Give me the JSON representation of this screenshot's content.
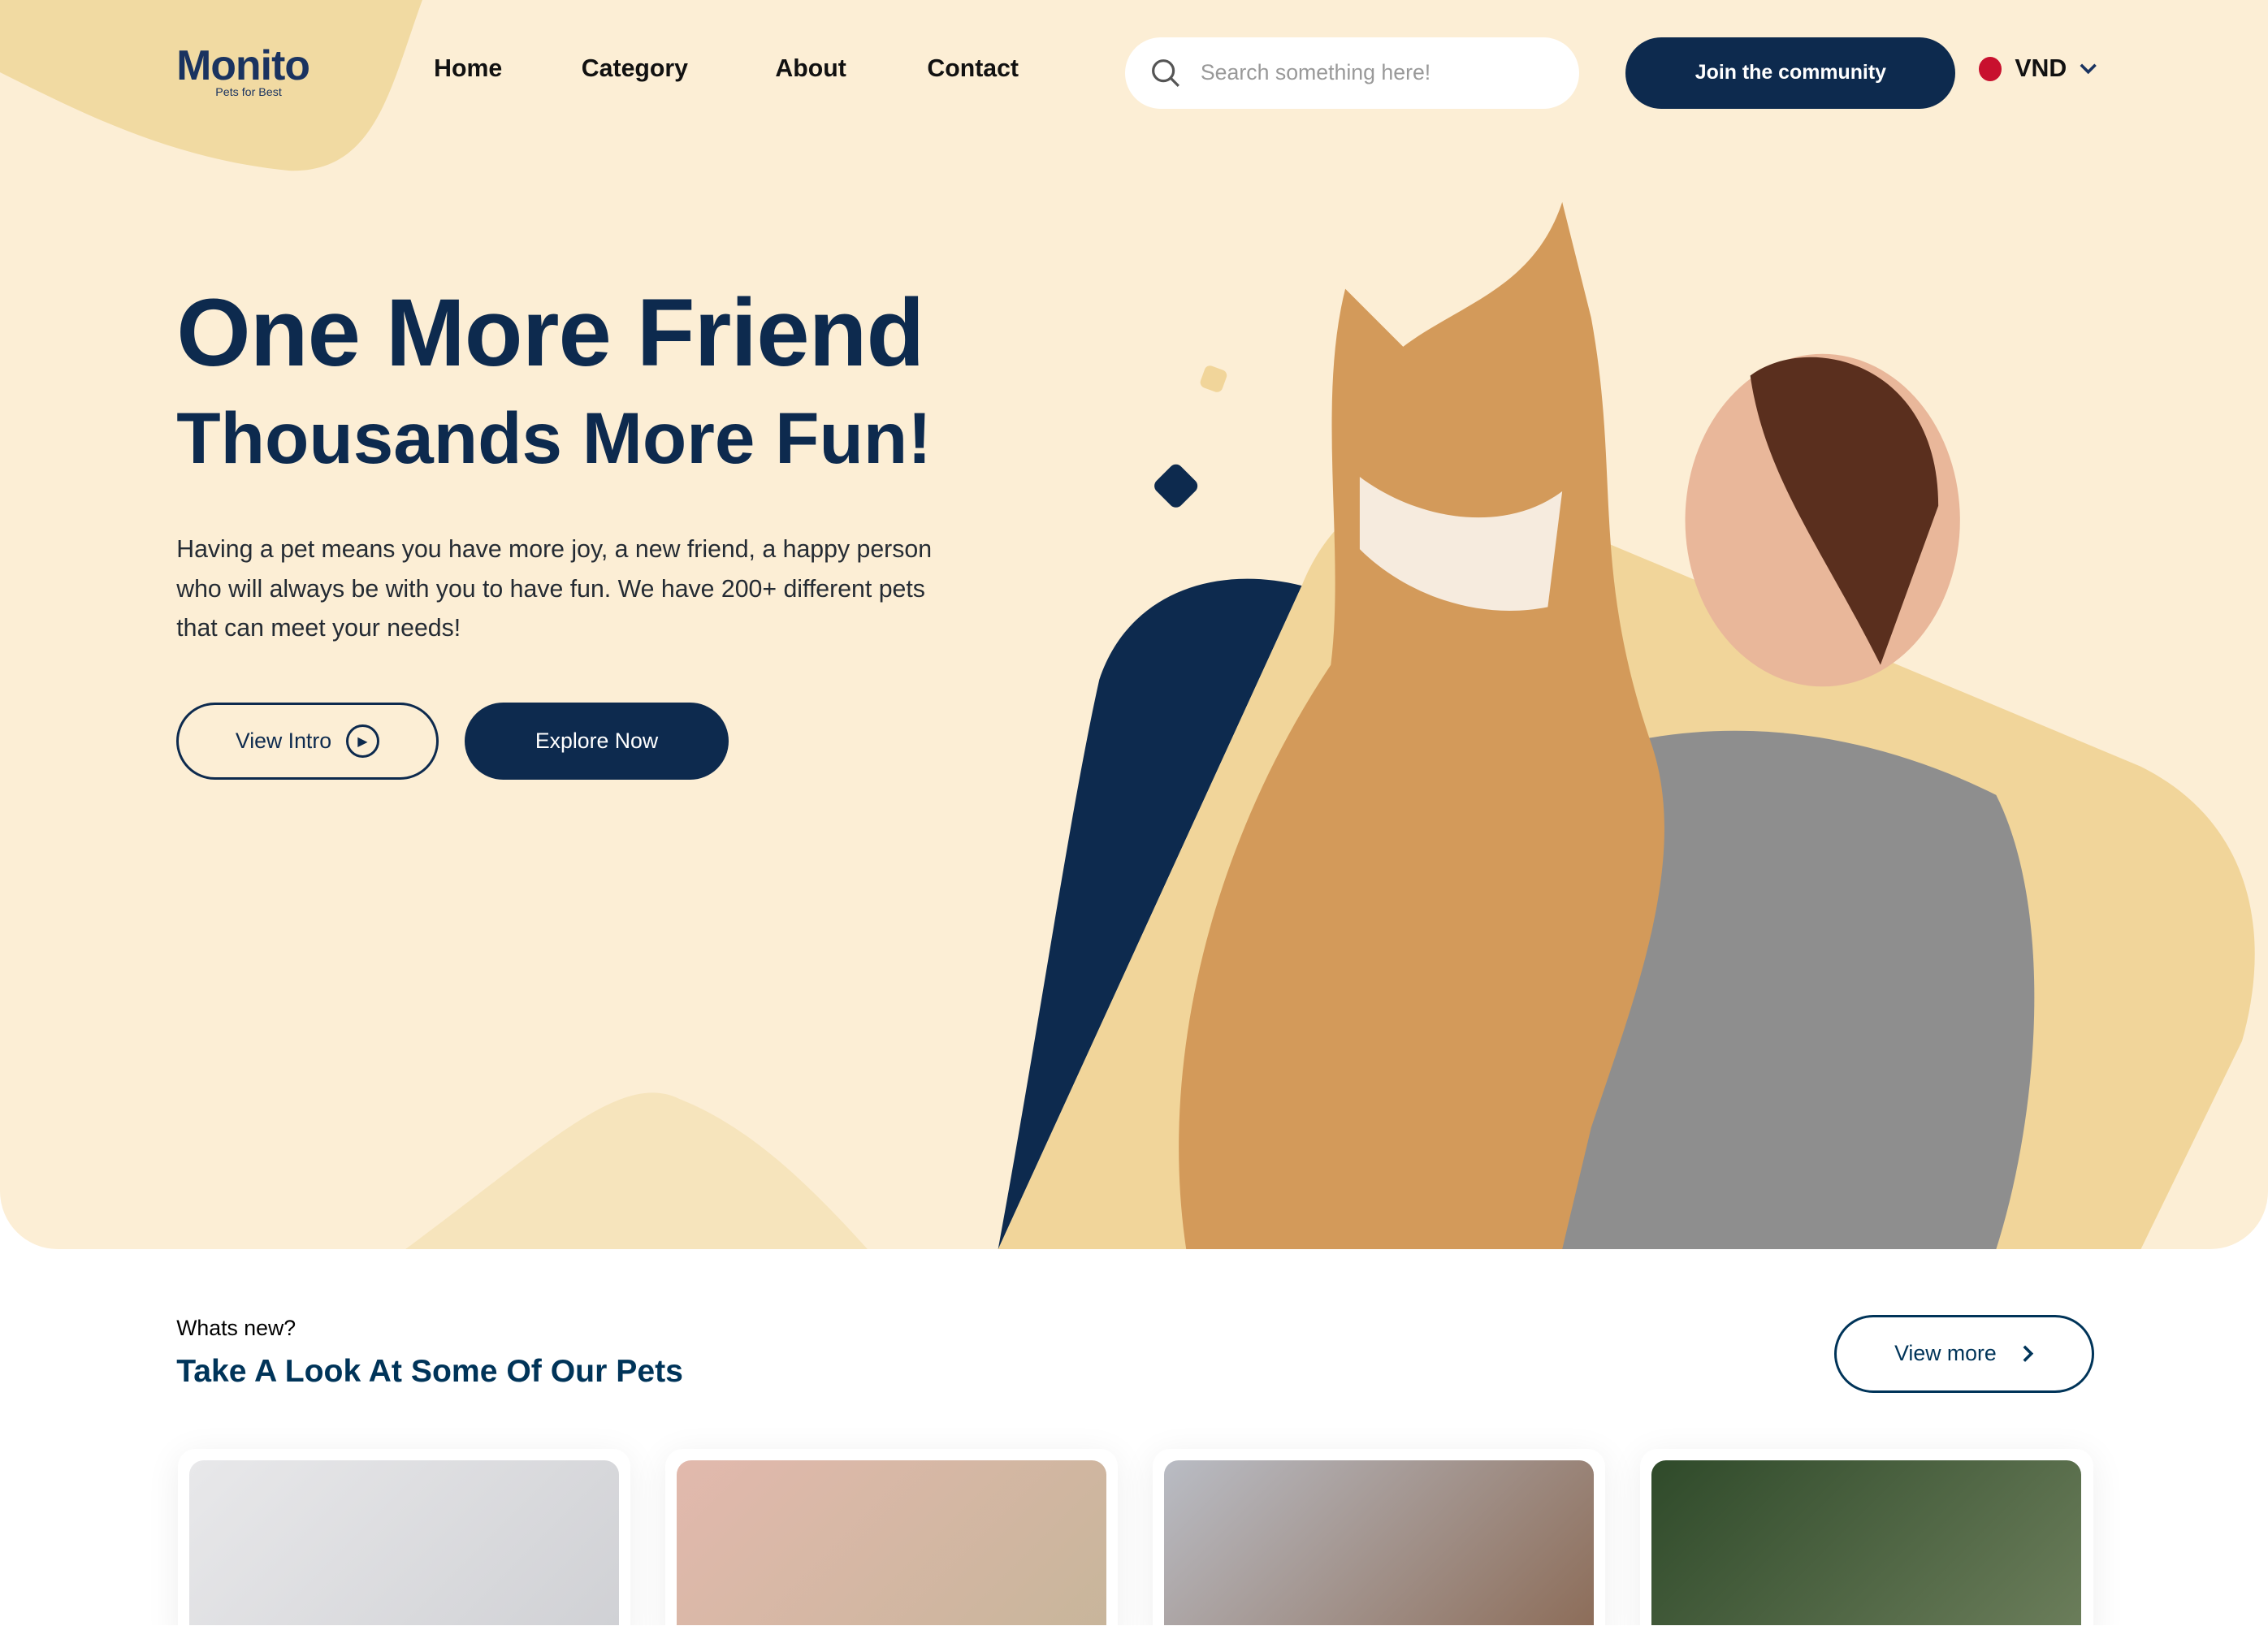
{
  "header": {
    "logo": {
      "name": "Monito",
      "tagline": "Pets for Best"
    },
    "nav": [
      {
        "label": "Home"
      },
      {
        "label": "Category"
      },
      {
        "label": "About"
      },
      {
        "label": "Contact"
      }
    ],
    "search": {
      "placeholder": "Search something here!",
      "value": ""
    },
    "join_button": "Join the community",
    "currency": {
      "label": "VND",
      "flag_color": "#C8102E"
    }
  },
  "hero": {
    "title": "One More Friend",
    "subtitle": "Thousands More Fun!",
    "description": "Having a pet means you have more joy, a new friend, a happy person who will always be with you to have fun. We have 200+ different pets that can meet your needs!",
    "view_intro": "View Intro",
    "explore": "Explore Now"
  },
  "pets_section": {
    "subtitle": "Whats new?",
    "title": "Take A Look At Some Of Our Pets",
    "view_more": "View more"
  },
  "colors": {
    "primary": "#0D2A4E",
    "hero_bg": "#FCEED5",
    "accent": "#F1D59A"
  }
}
